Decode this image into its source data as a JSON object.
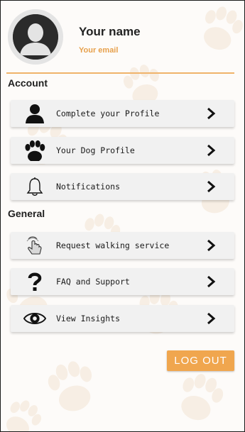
{
  "profile": {
    "name": "Your name",
    "email": "Your email"
  },
  "sections": {
    "account_title": "Account",
    "general_title": "General"
  },
  "account_items": [
    {
      "label": "Complete your Profile",
      "icon": "user-silhouette-icon"
    },
    {
      "label": "Your Dog Profile",
      "icon": "paw-icon"
    },
    {
      "label": "Notifications",
      "icon": "bell-icon"
    }
  ],
  "general_items": [
    {
      "label": "Request walking service",
      "icon": "touch-hand-icon"
    },
    {
      "label": "FAQ and Support",
      "icon": "question-mark-icon"
    },
    {
      "label": "View Insights",
      "icon": "eye-icon"
    }
  ],
  "logout_label": "LOG OUT",
  "colors": {
    "accent": "#f0a64e",
    "email_text": "#e7a04b",
    "divider": "#f0b36a",
    "item_background": "#f1f1f1"
  }
}
